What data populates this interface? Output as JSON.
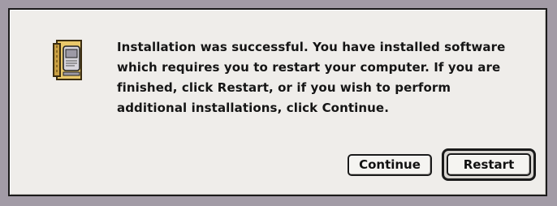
{
  "dialog": {
    "message": "Installation was successful. You have installed software which requires you to restart your computer. If you are finished, click Restart, or if you wish to perform additional installations, click Continue.",
    "icon": "installer-icon"
  },
  "buttons": {
    "continue_label": "Continue",
    "restart_label": "Restart",
    "default_button": "Restart"
  },
  "colors": {
    "desktop_background": "#a29ba6",
    "dialog_background": "#efedea",
    "border": "#1a1a1a"
  }
}
